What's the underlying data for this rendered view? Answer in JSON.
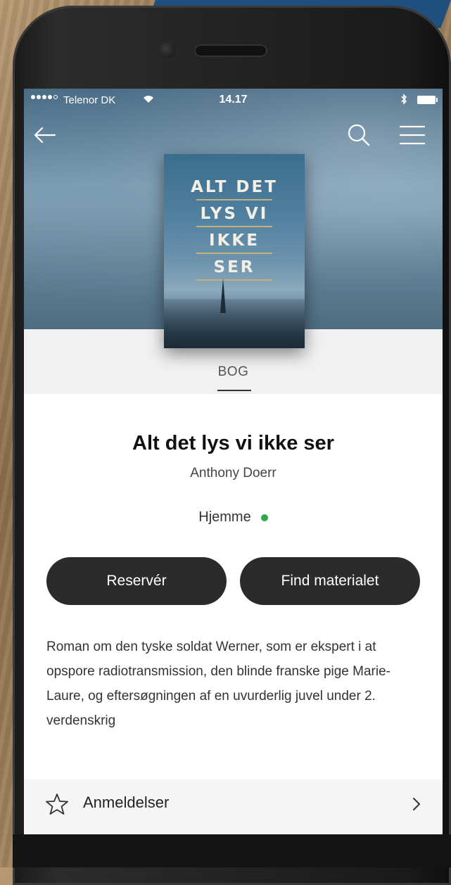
{
  "status_bar": {
    "carrier": "Telenor DK",
    "time": "14.17"
  },
  "navigation": {
    "back_icon": "arrow-left-icon",
    "search_icon": "search-icon",
    "menu_icon": "hamburger-menu-icon"
  },
  "cover": {
    "title_lines": [
      "ALT DET",
      "LYS VI",
      "IKKE",
      "SER"
    ]
  },
  "material_type": "BOG",
  "book": {
    "title": "Alt det lys vi ikke ser",
    "author": "Anthony Doerr",
    "availability": "Hjemme",
    "availability_color": "#2aa84a"
  },
  "actions": {
    "reserve_label": "Reservér",
    "find_label": "Find materialet"
  },
  "description": "Roman om den tyske soldat Werner, som er ekspert i at opspore radiotransmission, den blinde franske pige Marie-Laure, og eftersøgningen af en uvurderlig juvel under 2. verdenskrig",
  "reviews": {
    "label": "Anmeldelser",
    "icon": "star-outline-icon",
    "chevron_icon": "chevron-right-icon"
  },
  "colors": {
    "button_bg": "#2b2b2b",
    "accent_band": "#1f4f7c"
  }
}
